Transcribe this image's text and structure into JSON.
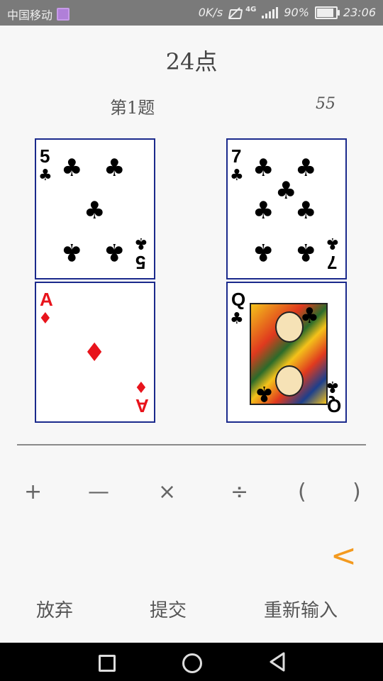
{
  "status_bar": {
    "carrier": "中国移动",
    "net_speed": "0K/s",
    "network_type": "4G",
    "battery": "90%",
    "battery_level": 0.9,
    "time": "23:06"
  },
  "game": {
    "title": "24点",
    "question": "第1题",
    "score": "55"
  },
  "cards": [
    {
      "rank": "5",
      "suit": "♣",
      "color": "#000000"
    },
    {
      "rank": "7",
      "suit": "♣",
      "color": "#000000"
    },
    {
      "rank": "A",
      "suit": "♦",
      "color": "#e8141c"
    },
    {
      "rank": "Q",
      "suit": "♣",
      "color": "#000000"
    }
  ],
  "operators": {
    "plus": "+",
    "minus": "—",
    "times": "×",
    "divide": "÷",
    "open_paren": "(",
    "close_paren": ")"
  },
  "back_symbol": "<",
  "actions": {
    "give_up": "放弃",
    "submit": "提交",
    "reenter": "重新输入"
  },
  "colors": {
    "accent": "#f39a1f",
    "card_border": "#1b2a8c",
    "red_suit": "#e8141c"
  }
}
